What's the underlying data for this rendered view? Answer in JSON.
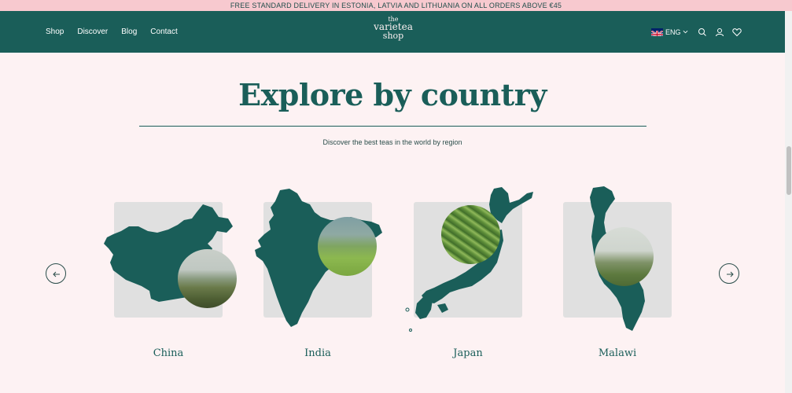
{
  "promo": {
    "text": "FREE STANDARD DELIVERY IN ESTONIA, LATVIA AND LITHUANIA ON ALL ORDERS ABOVE €45"
  },
  "header": {
    "nav": [
      "Shop",
      "Discover",
      "Blog",
      "Contact"
    ],
    "logo": {
      "line1": "the",
      "line2": "varietea",
      "line3": "shop"
    },
    "language": "ENG",
    "icons": [
      "uk-flag-icon",
      "chevron-down-icon",
      "search-icon",
      "user-icon",
      "heart-icon"
    ]
  },
  "section": {
    "title": "Explore by country",
    "subtitle": "Discover the best teas in the world by region"
  },
  "countries": [
    {
      "name": "China"
    },
    {
      "name": "India"
    },
    {
      "name": "Japan"
    },
    {
      "name": "Malawi"
    }
  ],
  "colors": {
    "brand": "#1a5e59",
    "promo_bg": "#f7c9cf",
    "page_bg": "#fdf2f3",
    "card_bg": "#e0e0e0"
  }
}
